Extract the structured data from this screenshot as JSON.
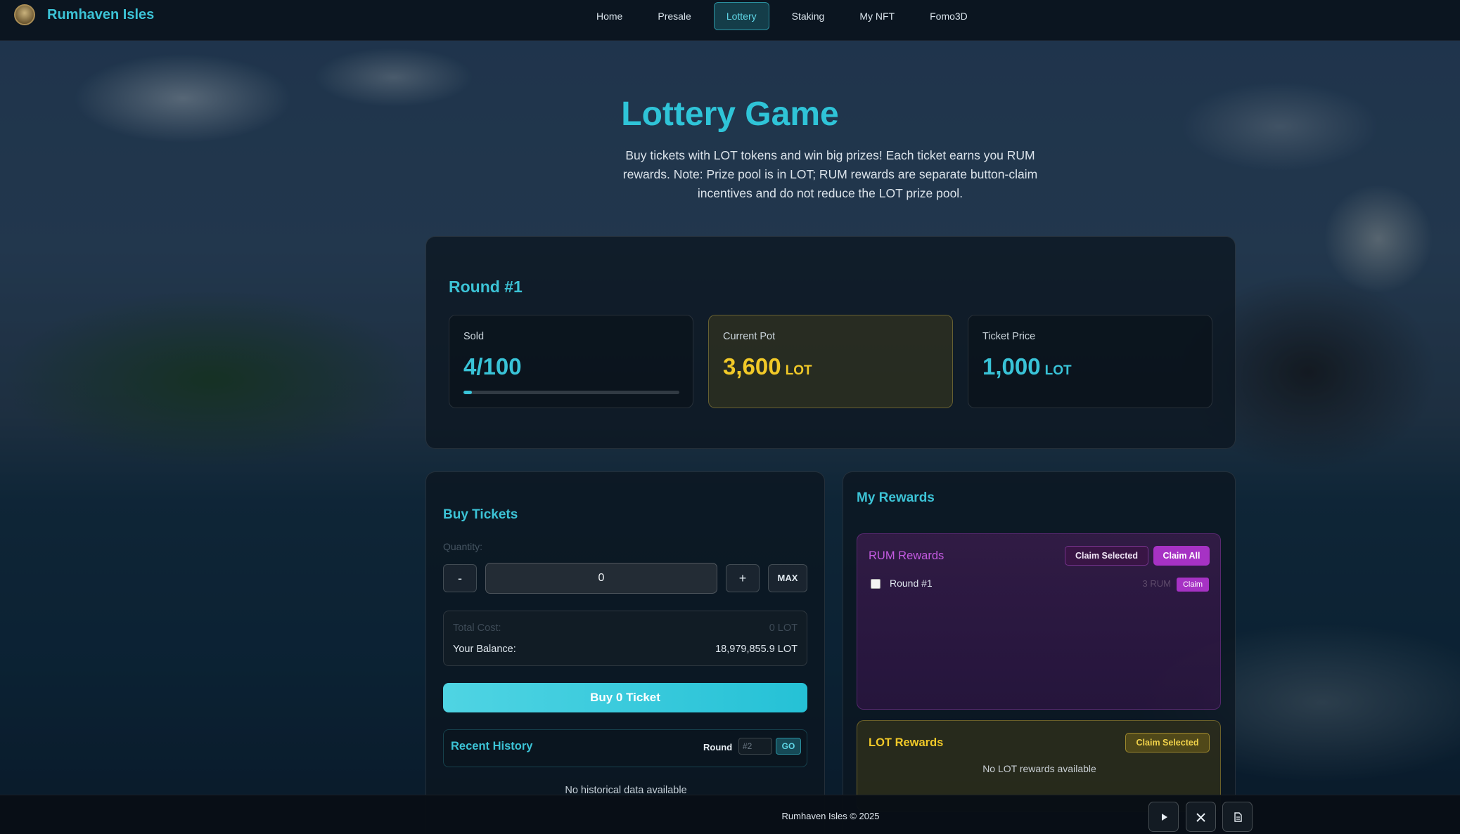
{
  "app": {
    "brand": "Rumhaven Isles"
  },
  "nav": {
    "items": [
      {
        "label": "Home",
        "active": false
      },
      {
        "label": "Presale",
        "active": false
      },
      {
        "label": "Lottery",
        "active": true
      },
      {
        "label": "Staking",
        "active": false
      },
      {
        "label": "My NFT",
        "active": false
      },
      {
        "label": "Fomo3D",
        "active": false
      }
    ]
  },
  "hero": {
    "title": "Lottery Game",
    "description": "Buy tickets with LOT tokens and win big prizes! Each ticket earns you RUM rewards. Note: Prize pool is in LOT; RUM rewards are separate button-claim incentives and do not reduce the LOT prize pool."
  },
  "round": {
    "title": "Round #1",
    "sold": {
      "label": "Sold",
      "value": "4/100",
      "progress_percent": 4
    },
    "pot": {
      "label": "Current Pot",
      "value": "3,600",
      "unit": "LOT"
    },
    "price": {
      "label": "Ticket Price",
      "value": "1,000",
      "unit": "LOT"
    }
  },
  "buy": {
    "title": "Buy Tickets",
    "quantity_label": "Quantity:",
    "minus_label": "-",
    "plus_label": "+",
    "quantity_value": "0",
    "max_label": "MAX",
    "total_cost_label": "Total Cost:",
    "total_cost_value": "0 LOT",
    "balance_label": "Your Balance:",
    "balance_value": "18,979,855.9 LOT",
    "buy_button": "Buy 0 Ticket",
    "history_title": "Recent History",
    "round_label": "Round",
    "round_placeholder": "#2",
    "go_label": "GO",
    "no_history": "No historical data available"
  },
  "rewards": {
    "title": "My Rewards",
    "rum": {
      "title": "RUM Rewards",
      "claim_selected": "Claim Selected",
      "claim_all": "Claim All",
      "rows": [
        {
          "label": "Round #1",
          "amount": "3 RUM",
          "claim": "Claim"
        }
      ]
    },
    "lot": {
      "title": "LOT Rewards",
      "claim_selected": "Claim Selected",
      "empty": "No LOT rewards available"
    }
  },
  "footer": {
    "copyright": "Rumhaven Isles © 2025",
    "icons": [
      "play-icon",
      "x-icon",
      "document-icon"
    ]
  },
  "colors": {
    "accent_cyan": "#39c3d7",
    "pot_yellow": "#f1c928",
    "rum_purple": "#a632c4"
  }
}
